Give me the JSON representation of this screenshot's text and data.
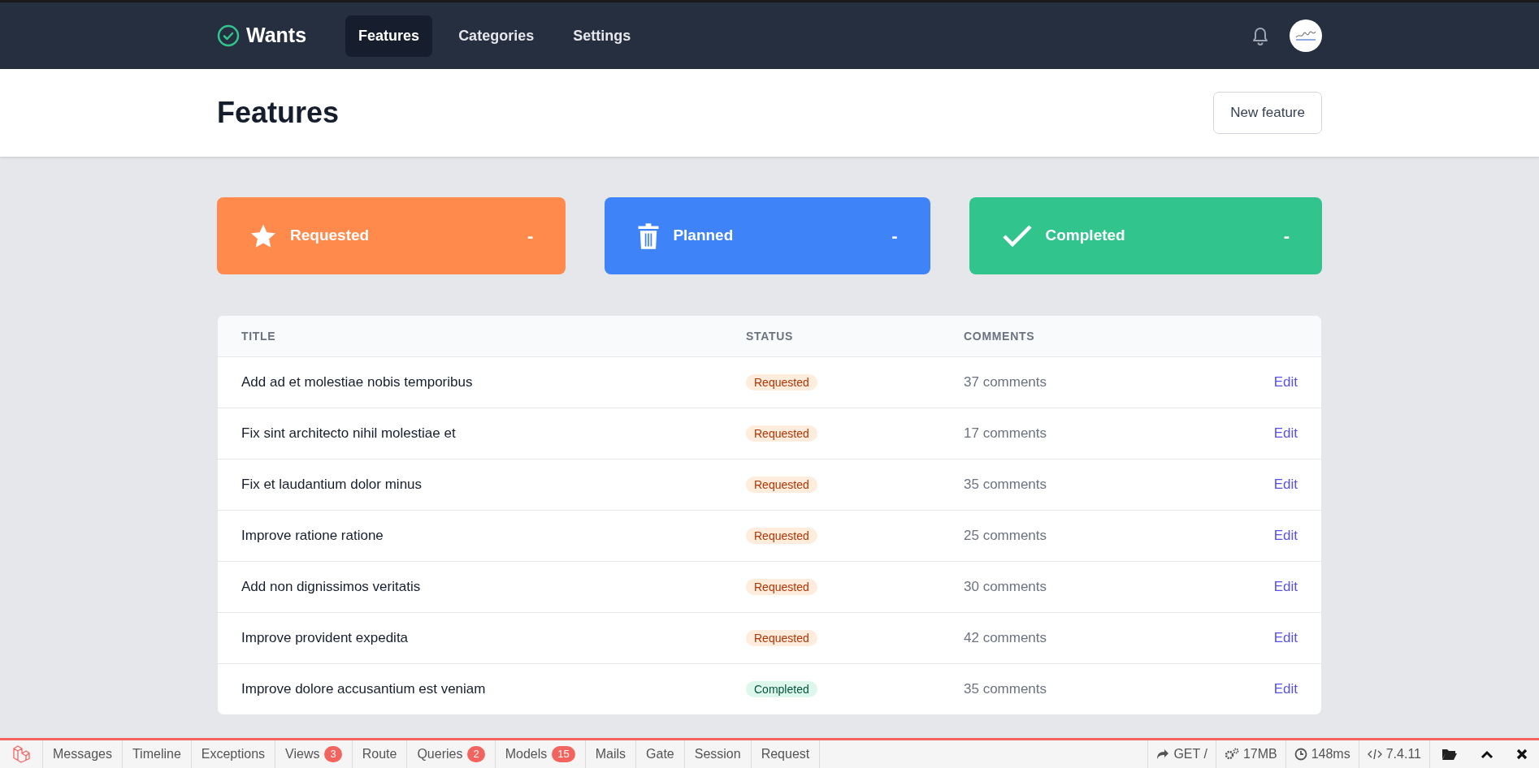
{
  "brand": {
    "name": "Wants"
  },
  "nav": [
    {
      "label": "Features",
      "selected": true
    },
    {
      "label": "Categories",
      "selected": false
    },
    {
      "label": "Settings",
      "selected": false
    }
  ],
  "header": {
    "title": "Features",
    "button": "New feature"
  },
  "stats": [
    {
      "kind": "requested",
      "label": "Requested",
      "value": "-",
      "color": "#ff8a4c"
    },
    {
      "kind": "planned",
      "label": "Planned",
      "value": "-",
      "color": "#3f83f8"
    },
    {
      "kind": "completed",
      "label": "Completed",
      "value": "-",
      "color": "#31c48d"
    }
  ],
  "table": {
    "columns": [
      "TITLE",
      "STATUS",
      "COMMENTS"
    ],
    "rows": [
      {
        "title": "Add ad et molestiae nobis temporibus",
        "status": "Requested",
        "kind": "requested",
        "comments": "37 comments",
        "action": "Edit"
      },
      {
        "title": "Fix sint architecto nihil molestiae et",
        "status": "Requested",
        "kind": "requested",
        "comments": "17 comments",
        "action": "Edit"
      },
      {
        "title": "Fix et laudantium dolor minus",
        "status": "Requested",
        "kind": "requested",
        "comments": "35 comments",
        "action": "Edit"
      },
      {
        "title": "Improve ratione ratione",
        "status": "Requested",
        "kind": "requested",
        "comments": "25 comments",
        "action": "Edit"
      },
      {
        "title": "Add non dignissimos veritatis",
        "status": "Requested",
        "kind": "requested",
        "comments": "30 comments",
        "action": "Edit"
      },
      {
        "title": "Improve provident expedita",
        "status": "Requested",
        "kind": "requested",
        "comments": "42 comments",
        "action": "Edit"
      },
      {
        "title": "Improve dolore accusantium est veniam",
        "status": "Completed",
        "kind": "completed",
        "comments": "35 comments",
        "action": "Edit"
      }
    ]
  },
  "debugbar": {
    "tabs": [
      {
        "label": "Messages"
      },
      {
        "label": "Timeline"
      },
      {
        "label": "Exceptions"
      },
      {
        "label": "Views",
        "count": "3"
      },
      {
        "label": "Route"
      },
      {
        "label": "Queries",
        "count": "2"
      },
      {
        "label": "Models",
        "count": "15"
      },
      {
        "label": "Mails"
      },
      {
        "label": "Gate"
      },
      {
        "label": "Session"
      },
      {
        "label": "Request"
      }
    ],
    "info": [
      {
        "kind": "method",
        "text": "GET /"
      },
      {
        "kind": "memory",
        "text": "17MB"
      },
      {
        "kind": "time",
        "text": "148ms"
      },
      {
        "kind": "version",
        "text": "7.4.11"
      }
    ]
  }
}
